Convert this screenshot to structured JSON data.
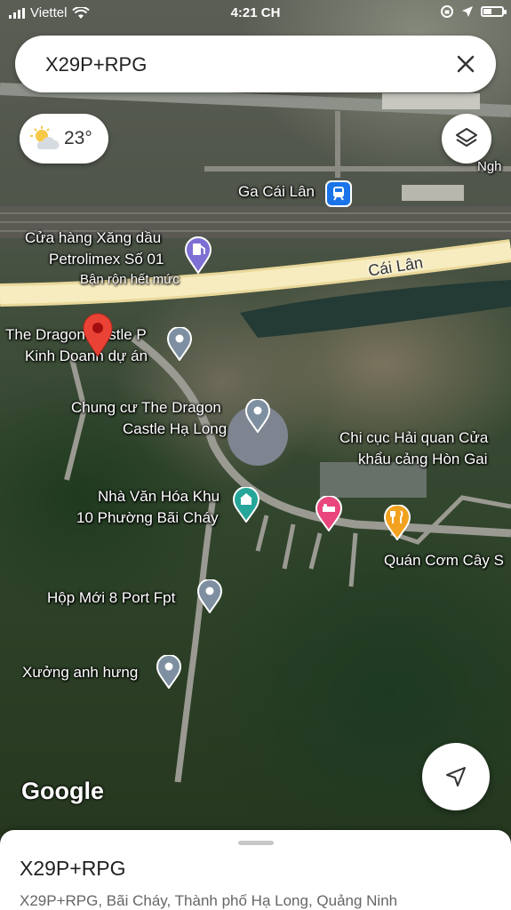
{
  "status_bar": {
    "carrier": "Viettel",
    "time": "4:21 CH"
  },
  "search": {
    "query": "X29P+RPG"
  },
  "weather": {
    "temperature": "23°",
    "icon": "partly-cloudy-icon"
  },
  "map": {
    "labels": {
      "nghe": "Ngh",
      "ga_cai_lan": "Ga Cái Lân",
      "petrolimex_line1": "Cửa hàng Xăng dầu",
      "petrolimex_line2": "Petrolimex Số 01",
      "petrolimex_status": "Bận rộn hết mức",
      "cai_lan_road": "Cái Lân",
      "dragon_castle_line1": "The Dragon Castle P",
      "dragon_castle_line2": "Kinh Doanh dự án",
      "chung_cu_line1": "Chung cư The Dragon",
      "chung_cu_line2": "Castle Hạ Long",
      "hai_quan_line1": "Chi cục Hải quan Cửa",
      "hai_quan_line2": "khẩu cảng Hòn Gai",
      "nha_van_hoa_line1": "Nhà Văn Hóa Khu",
      "nha_van_hoa_line2": "10 Phường Bãi Cháy",
      "quan_com": "Quán Cơm Cây S",
      "hop_moi": "Hộp Mới 8 Port Fpt",
      "xuong": "Xưởng anh hưng"
    },
    "colors": {
      "pin_red": "#ea4335",
      "pin_gray": "#7d8fa0",
      "pin_pink": "#e8467c",
      "pin_orange": "#f2a21f",
      "pin_teal": "#26a69a",
      "station_blue": "#1a73e8",
      "gas_purple": "#7e6fd4"
    }
  },
  "attribution": "Google",
  "place_sheet": {
    "title": "X29P+RPG",
    "address": "X29P+RPG, Bãi Cháy, Thành phố Hạ Long, Quảng Ninh"
  }
}
